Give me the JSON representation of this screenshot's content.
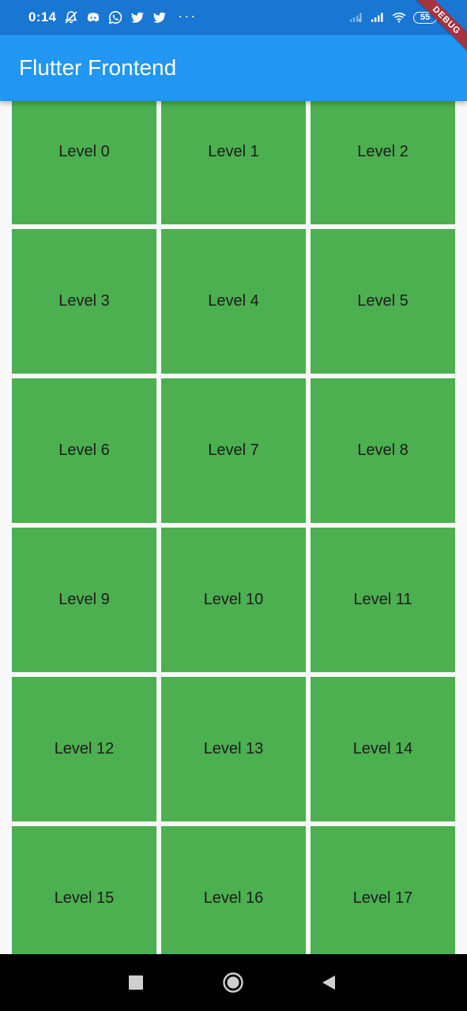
{
  "status_bar": {
    "time": "0:14",
    "left_icons": [
      "mute-notifications-icon",
      "discord-icon",
      "whatsapp-icon",
      "twitter-icon",
      "twitter-icon"
    ],
    "more": "···",
    "right_icons": [
      "signal-icon",
      "signal-icon",
      "wifi-icon"
    ],
    "battery": "55"
  },
  "debug_banner": "DEBUG",
  "app_bar": {
    "title": "Flutter Frontend"
  },
  "levels": [
    "Level 0",
    "Level 1",
    "Level 2",
    "Level 3",
    "Level 4",
    "Level 5",
    "Level 6",
    "Level 7",
    "Level 8",
    "Level 9",
    "Level 10",
    "Level 11",
    "Level 12",
    "Level 13",
    "Level 14",
    "Level 15",
    "Level 16",
    "Level 17"
  ],
  "colors": {
    "status_bar": "#1976d2",
    "app_bar": "#2196f3",
    "tile": "#4caf50",
    "nav_bar": "#000000"
  },
  "nav_bar": [
    "recents-button",
    "home-button",
    "back-button"
  ]
}
